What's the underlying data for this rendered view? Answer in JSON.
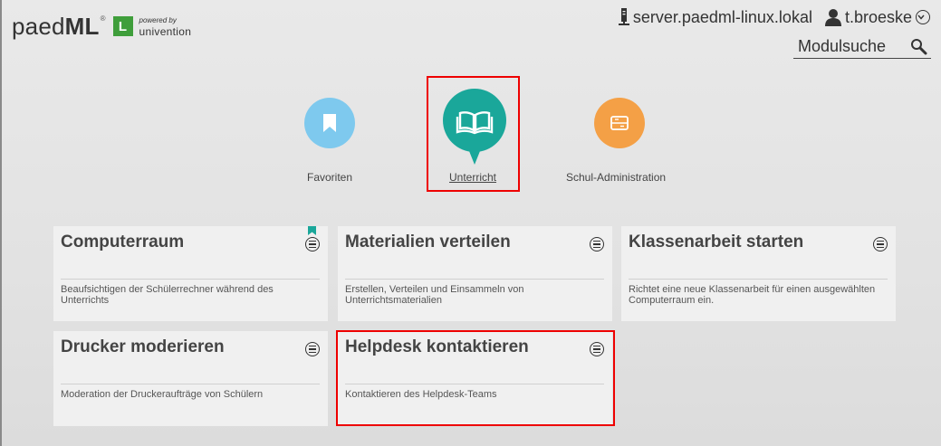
{
  "header": {
    "logo_main": "paed",
    "logo_bold": "ML",
    "logo_reg": "®",
    "logo_badge": "L",
    "powered_by": "powered by",
    "vendor": "univention",
    "server": "server.paedml-linux.lokal",
    "user": "t.broeske",
    "search_placeholder": "Modulsuche"
  },
  "categories": [
    {
      "label": "Favoriten",
      "color": "#7ec9ee",
      "icon": "bookmark-icon"
    },
    {
      "label": "Unterricht",
      "color": "#1aa79a",
      "icon": "open-book-icon",
      "selected": true
    },
    {
      "label": "Schul-Administration",
      "color": "#f4a046",
      "icon": "school-admin-icon"
    }
  ],
  "tiles": [
    {
      "title": "Computerraum",
      "description": "Beaufsichtigen der Schülerrechner während des Unterrichts",
      "favorite": true
    },
    {
      "title": "Materialien verteilen",
      "description": "Erstellen, Verteilen und Einsammeln von Unterrichtsmaterialien"
    },
    {
      "title": "Klassenarbeit starten",
      "description": "Richtet eine neue Klassenarbeit für einen ausgewählten Computerraum ein."
    },
    {
      "title": "Drucker moderieren",
      "description": "Moderation der Druckeraufträge von Schülern"
    },
    {
      "title": "Helpdesk kontaktieren",
      "description": "Kontaktieren des Helpdesk-Teams"
    }
  ],
  "colors": {
    "highlight": "#e00000",
    "accent": "#1aa79a",
    "logo_green": "#3f9e3b"
  }
}
